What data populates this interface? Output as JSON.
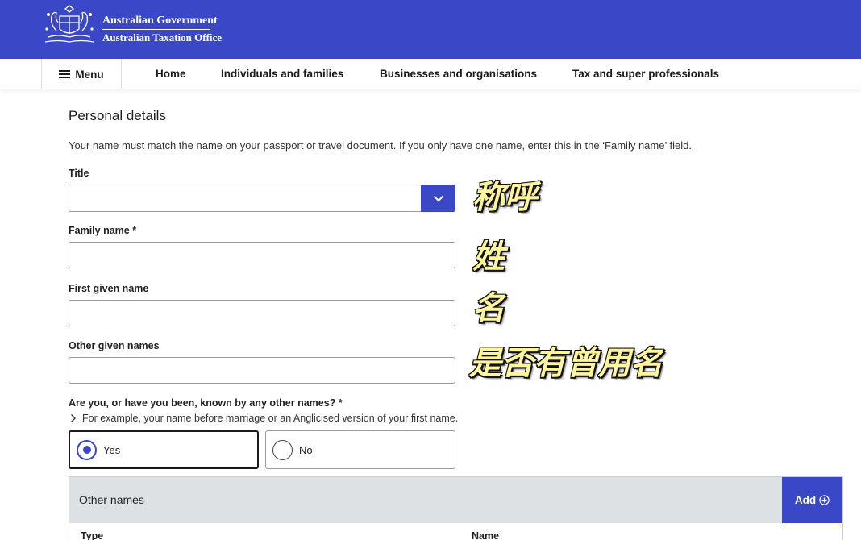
{
  "header": {
    "line1": "Australian Government",
    "line2": "Australian Taxation Office",
    "bg_color": "#3a48c8"
  },
  "nav": {
    "menu_label": "Menu",
    "links": [
      "Home",
      "Individuals and families",
      "Businesses and organisations",
      "Tax and super professionals"
    ]
  },
  "form": {
    "section_title": "Personal details",
    "intro": "Your name must match the name on your passport or travel document. If you only have one name, enter this in the ‘Family name’ field.",
    "title_label": "Title",
    "title_value": "",
    "family_name_label": "Family name *",
    "first_given_label": "First given name",
    "other_given_label": "Other given names",
    "other_names_question": "Are you, or have you been, known by any other names? *",
    "other_names_hint": "For example, your name before marriage or an Anglicised version of your first name.",
    "radio_yes": "Yes",
    "radio_no": "No",
    "selected": "Yes"
  },
  "other_names_panel": {
    "title": "Other names",
    "add_label": "Add",
    "columns": [
      "Type",
      "Name"
    ]
  },
  "annotations": {
    "title": "称呼",
    "family": "姓",
    "given": "名",
    "other": "是否有曾用名"
  },
  "accent_color": "#3a48c8",
  "annotation_color": "#fff59c"
}
